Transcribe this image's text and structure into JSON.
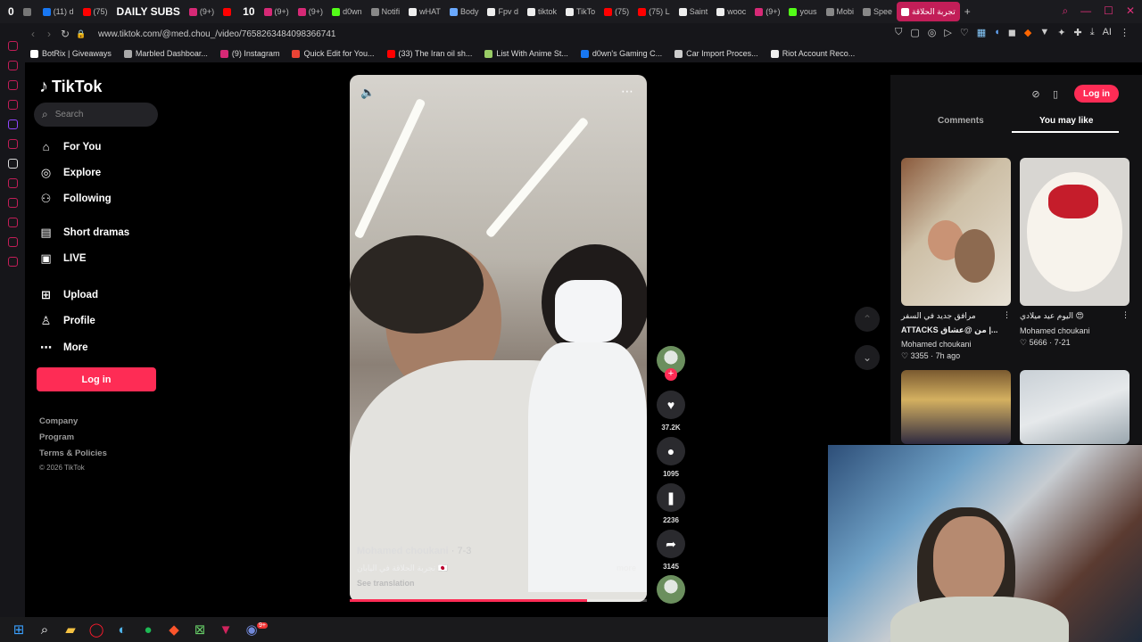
{
  "browser": {
    "tabs": [
      {
        "label": "0",
        "style": "bold",
        "color": "#e0307a"
      },
      {
        "label": "",
        "color": "#777"
      },
      {
        "label": "(11) d",
        "color": "#1877f2"
      },
      {
        "label": "(75)",
        "color": "#ff0000"
      },
      {
        "label": "DAILY SUBS",
        "style": "bold",
        "color": "#ff0000"
      },
      {
        "label": "(9+)",
        "color": "#d62976"
      },
      {
        "label": "",
        "color": "#ff0000"
      },
      {
        "label": "10",
        "style": "bold",
        "color": "#ff0000"
      },
      {
        "label": "(9+)",
        "color": "#d62976"
      },
      {
        "label": "(9+)",
        "color": "#d62976"
      },
      {
        "label": "d0wn",
        "color": "#53fc18"
      },
      {
        "label": "Notifi",
        "color": "#888"
      },
      {
        "label": "wHAT",
        "color": "#eee"
      },
      {
        "label": "Body",
        "color": "#6aa9ff"
      },
      {
        "label": "Fpv d",
        "color": "#eee"
      },
      {
        "label": "tiktok",
        "color": "#eee"
      },
      {
        "label": "TikTo",
        "color": "#eee"
      },
      {
        "label": "(75)",
        "color": "#ff0000"
      },
      {
        "label": "(75) L",
        "color": "#ff0000"
      },
      {
        "label": "Saint",
        "color": "#eee"
      },
      {
        "label": "wooc",
        "color": "#eee"
      },
      {
        "label": "(9+)",
        "color": "#d62976"
      },
      {
        "label": "yous",
        "color": "#53fc18"
      },
      {
        "label": "Mobi",
        "color": "#888"
      },
      {
        "label": "Spee",
        "color": "#888"
      },
      {
        "label": "تجربة الحلاقة",
        "style": "active",
        "color": "#fff"
      }
    ],
    "new_tab": "+",
    "url": "www.tiktok.com/@med.chou_/video/7658263484098366741",
    "ext_badge": "AI",
    "bookmarks": [
      {
        "label": "BotRix | Giveaways",
        "color": "#fff"
      },
      {
        "label": "Marbled Dashboar...",
        "color": "#aaa"
      },
      {
        "label": "(9) Instagram",
        "color": "#d62976"
      },
      {
        "label": "Quick Edit for You...",
        "color": "#ea4335"
      },
      {
        "label": "(33) The Iran oil sh...",
        "color": "#ff0000"
      },
      {
        "label": "List With Anime St...",
        "color": "#9c6"
      },
      {
        "label": "d0wn's Gaming C...",
        "color": "#1877f2"
      },
      {
        "label": "Car Import Proces...",
        "color": "#ccc"
      },
      {
        "label": "Riot Account Reco...",
        "color": "#eee"
      }
    ]
  },
  "tiktok": {
    "logo": "TikTok",
    "search_placeholder": "Search",
    "nav": [
      {
        "label": "For You",
        "icon": "home-icon",
        "top": 0
      },
      {
        "label": "Explore",
        "icon": "compass-icon"
      },
      {
        "label": "Following",
        "icon": "user-follow-icon"
      },
      {
        "label": "Short dramas",
        "icon": "film-icon"
      },
      {
        "label": "LIVE",
        "icon": "tv-icon"
      },
      {
        "label": "Upload",
        "icon": "plus-square-icon"
      },
      {
        "label": "Profile",
        "icon": "person-icon"
      },
      {
        "label": "More",
        "icon": "dots-icon"
      }
    ],
    "login": "Log in",
    "footer": [
      "Company",
      "Program",
      "Terms & Policies"
    ],
    "copyright": "© 2026 TikTok",
    "video": {
      "author": "Mohamed choukani",
      "date": "· 7-3",
      "caption": "تجربة الحلاقة في اليابان 🇯🇵",
      "see_translation": "See translation",
      "more": "more",
      "progress_fraction": 0.8
    },
    "actions": {
      "likes": "37.2K",
      "comments": "1095",
      "saves": "2236",
      "shares": "3145"
    },
    "panel": {
      "login": "Log in",
      "tabs": [
        "Comments",
        "You may like"
      ],
      "active_tab": "You may like",
      "cards": [
        {
          "title": "مرافق جديد في السفر",
          "title2": "ATTACKS ‏من @عشاق |...",
          "author": "Mohamed choukani",
          "likes": "3355",
          "date": "7h ago"
        },
        {
          "title": "اليوم عيد ميلادي 😍",
          "title2": "",
          "author": "Mohamed choukani",
          "likes": "5666",
          "date": "7-21"
        }
      ]
    }
  },
  "taskbar": {
    "icons": [
      "windows-icon",
      "search-icon",
      "folder-icon",
      "opera-icon",
      "edge-icon",
      "spotify-icon",
      "brave-icon",
      "xbox-icon",
      "app-icon",
      "discord-icon"
    ],
    "discord_badge": "9+"
  }
}
